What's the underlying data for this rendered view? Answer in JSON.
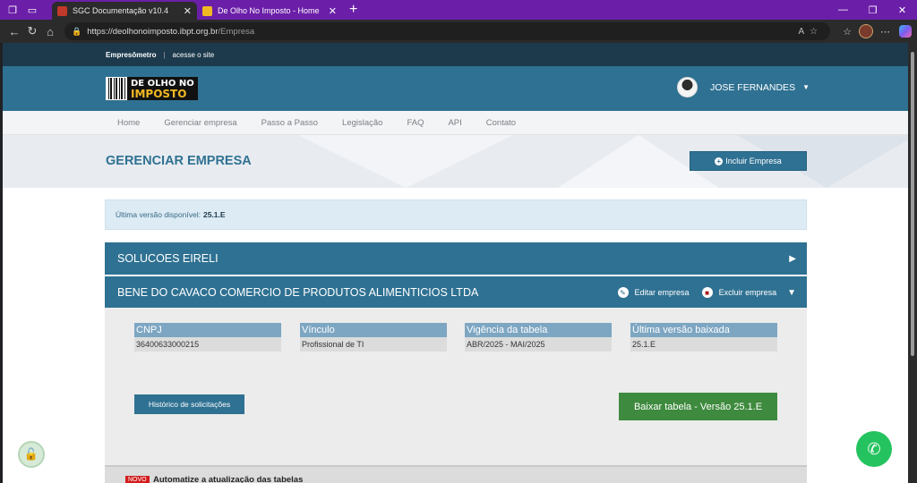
{
  "browser": {
    "tabs": [
      {
        "title": "SGC Documentação v10.4",
        "active": true
      },
      {
        "title": "De Olho No Imposto - Home",
        "active": false
      }
    ],
    "url_domain": "https://deolhonoimposto.ibpt.org.br",
    "url_path": "/Empresa"
  },
  "site": {
    "topstrip": {
      "brand": "Empresômetro",
      "link": "acesse o site"
    },
    "logo": {
      "line1": "DE OLHO NO",
      "line2": "IMPOSTO"
    },
    "user_name": "JOSE FERNANDES",
    "nav": [
      "Home",
      "Gerenciar empresa",
      "Passo a Passo",
      "Legislação",
      "FAQ",
      "API",
      "Contato"
    ],
    "page_title": "GERENCIAR EMPRESA",
    "add_button": "Incluir Empresa",
    "alert_label": "Última versão disponível:",
    "alert_version": "25.1.E"
  },
  "companies": [
    {
      "name": "SOLUCOES EIRELI"
    },
    {
      "name": "BENE DO CAVACO COMERCIO DE PRODUTOS ALIMENTICIOS LTDA",
      "edit": "Editar empresa",
      "delete": "Excluir empresa"
    }
  ],
  "details": {
    "fields": [
      {
        "label": "CNPJ",
        "value": "36400633000215"
      },
      {
        "label": "Vínculo",
        "value": "Profissional de TI"
      },
      {
        "label": "Vigência da tabela",
        "value": "ABR/2025 - MAI/2025"
      },
      {
        "label": "Última versão baixada",
        "value": "25.1.E"
      }
    ],
    "history_button": "Histórico de solicitações",
    "download_button": "Baixar tabela - Versão 25.1.E"
  },
  "promo": {
    "badge": "NOVO",
    "text": "Automatize a atualização das tabelas"
  },
  "colors": {
    "primary": "#2f7192",
    "download": "#3e8a3e",
    "tabbar": "#6b1fa8"
  }
}
